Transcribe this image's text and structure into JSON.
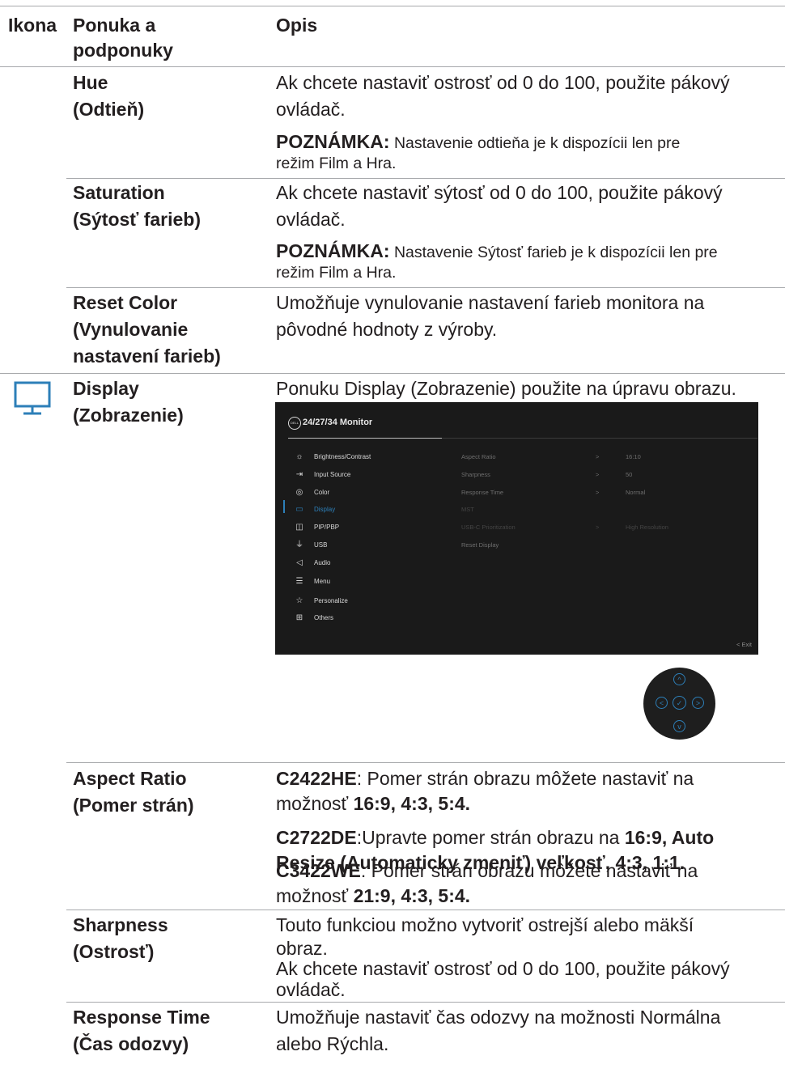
{
  "header": {
    "col_icon": "Ikona",
    "col_menu_l1": "Ponuka a",
    "col_menu_l2": "podponuky",
    "col_desc": "Opis"
  },
  "rows": {
    "hue": {
      "name_l1": "Hue",
      "name_l2": "(Odtieň)",
      "desc_l1": "Ak chcete nastaviť ostrosť od 0 do 100, použite pákový",
      "desc_l2": "ovládač.",
      "note_label": "POZNÁMKA:",
      "note_l1": " Nastavenie odtieňa je k dispozícii len pre",
      "note_l2": "režim Film a Hra."
    },
    "saturation": {
      "name_l1": "Saturation",
      "name_l2": "(Sýtosť farieb)",
      "desc_l1": "Ak chcete nastaviť sýtosť od 0 do 100, použite pákový",
      "desc_l2": "ovládač.",
      "note_label": "POZNÁMKA:",
      "note_l1": " Nastavenie Sýtosť farieb je k dispozícii len pre",
      "note_l2": "režim Film a Hra."
    },
    "reset_color": {
      "name_l1": "Reset Color",
      "name_l2": "(Vynulovanie",
      "name_l3": "nastavení farieb)",
      "desc_l1": "Umožňuje vynulovanie nastavení farieb monitora na",
      "desc_l2": "pôvodné hodnoty z výroby."
    },
    "display": {
      "name_l1": "Display",
      "name_l2": "(Zobrazenie)",
      "desc_l1": "Ponuku Display (Zobrazenie) použite na úpravu obrazu."
    },
    "aspect_ratio": {
      "name_l1": "Aspect Ratio",
      "name_l2": "(Pomer strán)",
      "a_model": "C2422HE",
      "a_l1": ": Pomer strán obrazu môžete nastaviť na",
      "a_l2a": "možnosť ",
      "a_l2b": "16:9, 4:3, 5:4.",
      "b_model": "C2722DE",
      "b_l1": ":Upravte pomer strán obrazu na ",
      "b_l1b": "16:9, Auto",
      "b_l2": "Resize (Automaticky zmeniť) veľkosť,  4:3,  1:1.",
      "c_model": "C3422WE",
      "c_l1": ": Pomer strán obrazu môžete nastaviť na",
      "c_l2a": "možnosť ",
      "c_l2b": "21:9, 4:3, 5:4."
    },
    "sharpness": {
      "name_l1": "Sharpness",
      "name_l2": "(Ostrosť)",
      "desc_l1": "Touto funkciou možno vytvoriť ostrejší alebo mäkší",
      "desc_l2": "obraz.",
      "desc_l3": "Ak chcete nastaviť ostrosť od 0 do 100, použite pákový",
      "desc_l4": "ovládač."
    },
    "response_time": {
      "name_l1": "Response Time",
      "name_l2": "(Čas odozvy)",
      "desc_l1": "Umožňuje nastaviť čas odozvy na možnosti Normálna",
      "desc_l2": "alebo Rýchla."
    }
  },
  "osd": {
    "logo": "DELL",
    "title": "24/27/34 Monitor",
    "menu": [
      {
        "icon": "sun-icon",
        "glyph": "☼",
        "label": "Brightness/Contrast"
      },
      {
        "icon": "input-source-icon",
        "glyph": "⇥",
        "label": "Input Source"
      },
      {
        "icon": "palette-icon",
        "glyph": "◎",
        "label": "Color"
      },
      {
        "icon": "monitor-icon",
        "glyph": "▭",
        "label": "Display"
      },
      {
        "icon": "pip-icon",
        "glyph": "◫",
        "label": "PIP/PBP"
      },
      {
        "icon": "usb-icon",
        "glyph": "⏚",
        "label": "USB"
      },
      {
        "icon": "speaker-icon",
        "glyph": "◁",
        "label": "Audio"
      },
      {
        "icon": "menu-icon",
        "glyph": "☰",
        "label": "Menu"
      },
      {
        "icon": "star-icon",
        "glyph": "☆",
        "label": "Personalize"
      },
      {
        "icon": "others-icon",
        "glyph": "⊞",
        "label": "Others"
      }
    ],
    "submenu": [
      {
        "label": "Aspect Ratio",
        "arrow": ">",
        "value": "16:10"
      },
      {
        "label": "Sharpness",
        "arrow": ">",
        "value": "50"
      },
      {
        "label": "Response Time",
        "arrow": ">",
        "value": "Normal"
      },
      {
        "label": "MST",
        "arrow": "",
        "value": ""
      },
      {
        "label": "USB-C Prioritization",
        "arrow": ">",
        "value": "High Resolution"
      },
      {
        "label": "Reset Display",
        "arrow": "",
        "value": ""
      }
    ],
    "exit": "<  Exit"
  },
  "joystick": {
    "up": "^",
    "left": "<",
    "center": "✓",
    "right": ">",
    "down": "v"
  },
  "colors": {
    "accent": "#2d7fb8",
    "osd_bg": "#1a1a1a",
    "rule": "#a7a9ac"
  }
}
